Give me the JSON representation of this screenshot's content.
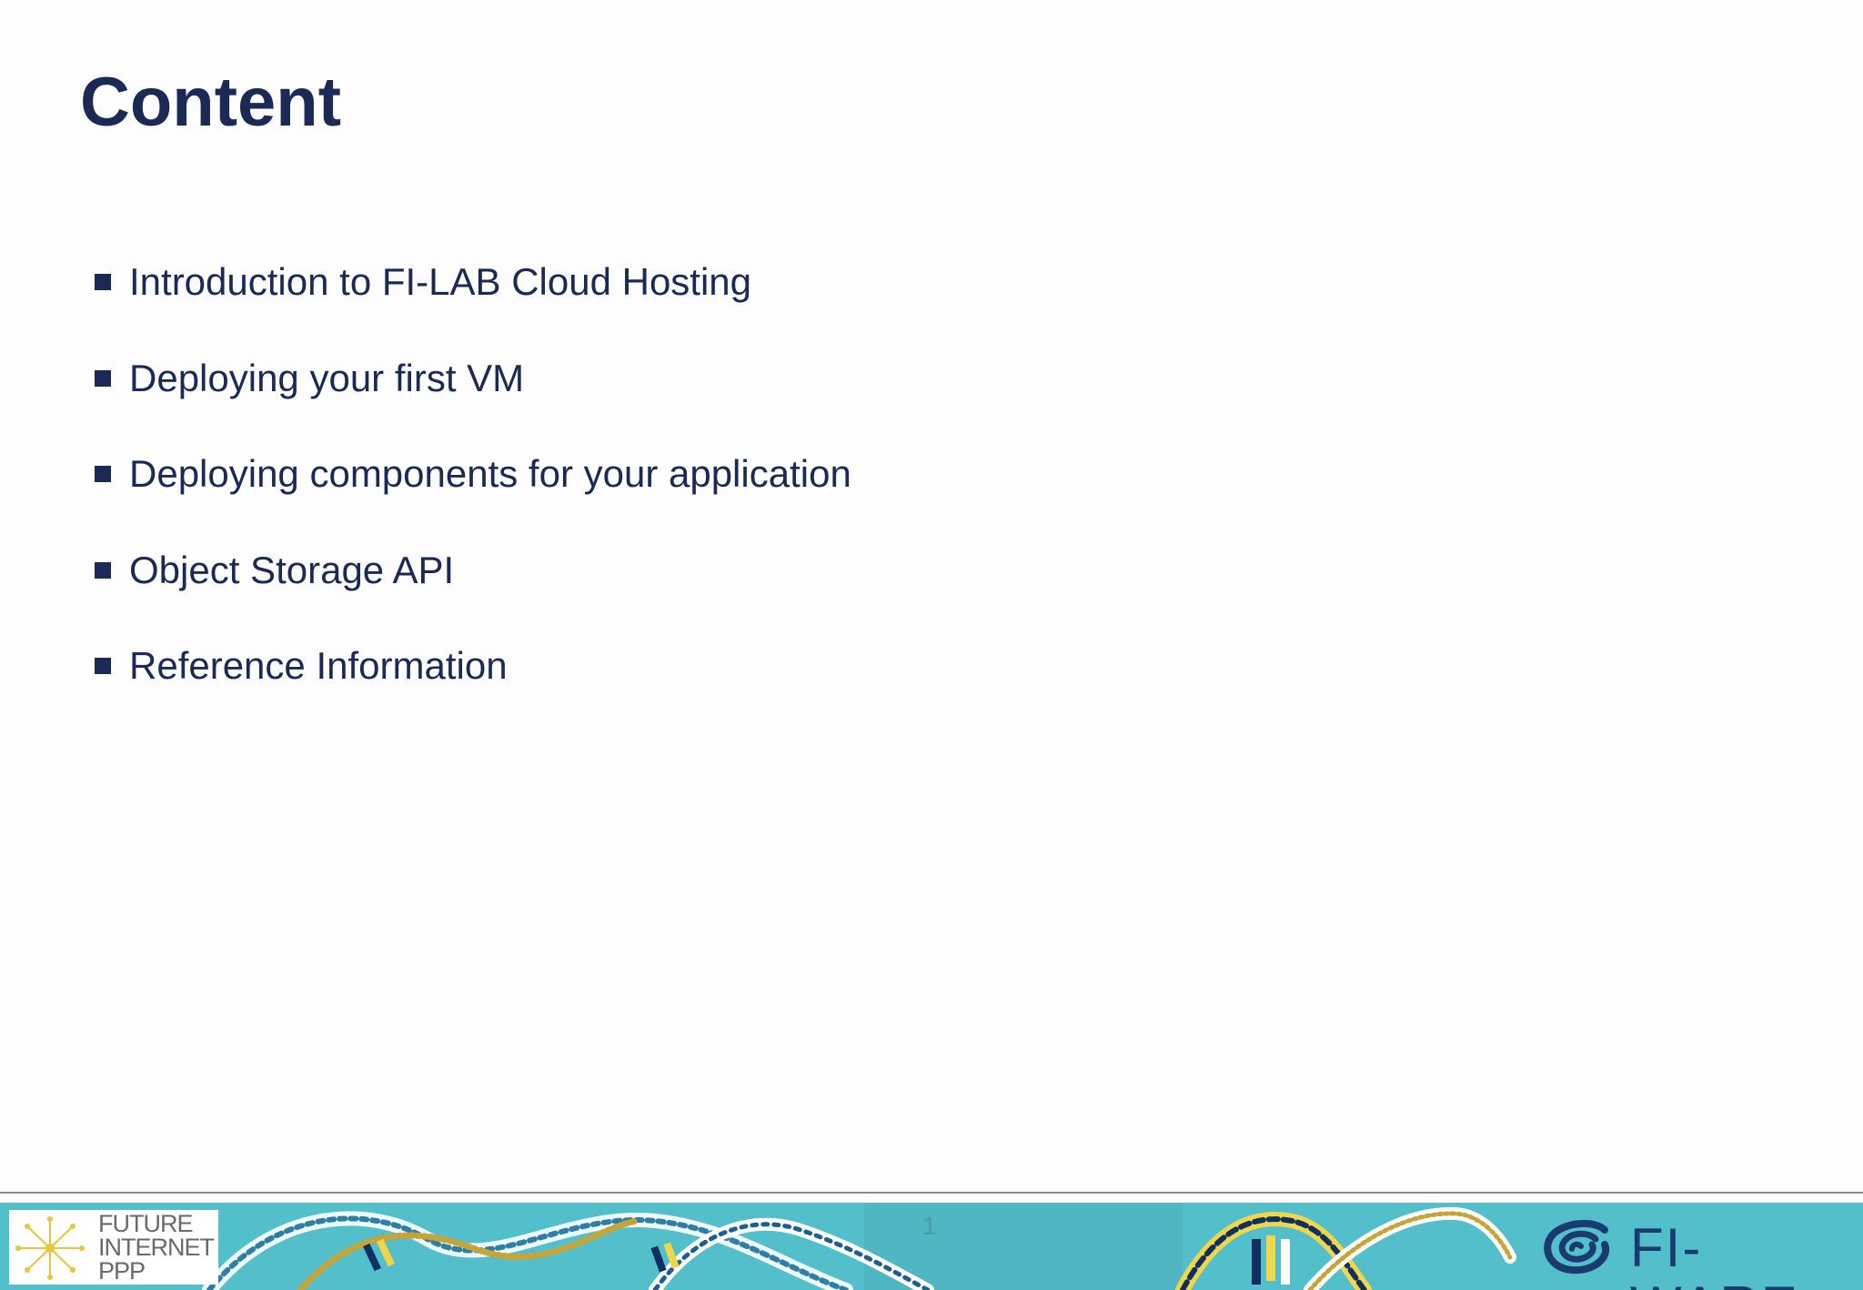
{
  "slide": {
    "title": "Content",
    "bullets": [
      "Introduction to FI-LAB Cloud Hosting",
      "Deploying your first VM",
      "Deploying components for your application",
      "Object Storage API",
      "Reference Information"
    ]
  },
  "footer": {
    "left_logo_text": "FUTURE\nINTERNET\nPPP",
    "page_number": "1",
    "right_logo_text": "FI-WARE"
  },
  "colors": {
    "title": "#1b2a55",
    "bullet": "#1b2a55",
    "footer_band": "#52bfcb",
    "fiware_logo": "#1b3b70"
  },
  "icons": {
    "bullet": "square-bullet-icon",
    "left_logo": "future-internet-ppp-logo",
    "right_logo": "fiware-logo"
  }
}
